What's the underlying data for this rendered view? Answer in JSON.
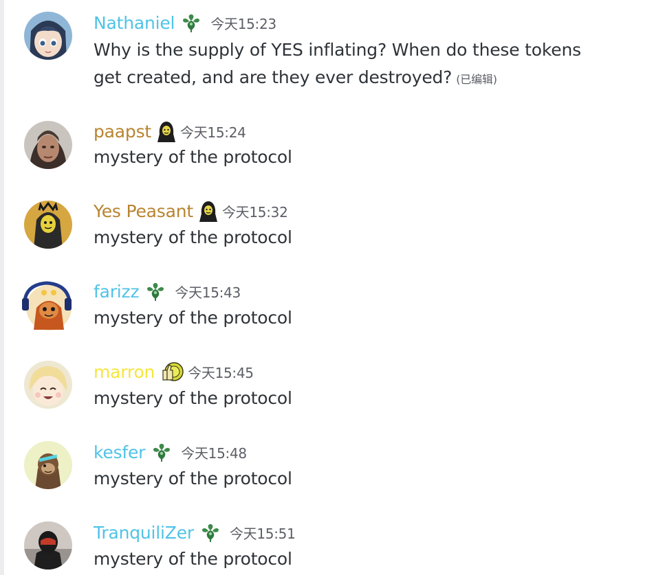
{
  "colors": {
    "teal_name": "#4fc3e8",
    "gold_name": "#b88430",
    "yellow_name": "#f5e63d",
    "text": "#2e3338",
    "timestamp": "#5c5e66"
  },
  "messages": [
    {
      "author": "Nathaniel",
      "badge": "green-flower-icon",
      "timestamp": "今天15:23",
      "lines": [
        "Why is the supply of YES inflating? When do these tokens",
        "get created, and are they ever destroyed?"
      ],
      "edited": "(已编辑)"
    },
    {
      "author": "paapst",
      "badge": "hooded-figure-icon",
      "timestamp": "今天15:24",
      "text": "mystery of the protocol"
    },
    {
      "author": "Yes Peasant",
      "badge": "hooded-figure-icon",
      "timestamp": "今天15:32",
      "text": "mystery of the protocol"
    },
    {
      "author": "farizz",
      "badge": "green-flower-icon",
      "timestamp": "今天15:43",
      "text": "mystery of the protocol"
    },
    {
      "author": "marron",
      "badge": "thumbs-up-coin-icon",
      "timestamp": "今天15:45",
      "text": "mystery of the protocol"
    },
    {
      "author": "kesfer",
      "badge": "green-flower-icon",
      "timestamp": "今天15:48",
      "text": "mystery of the protocol"
    },
    {
      "author": "TranquiliZer",
      "badge": "green-flower-icon",
      "timestamp": "今天15:51",
      "text": "mystery of the protocol"
    }
  ]
}
